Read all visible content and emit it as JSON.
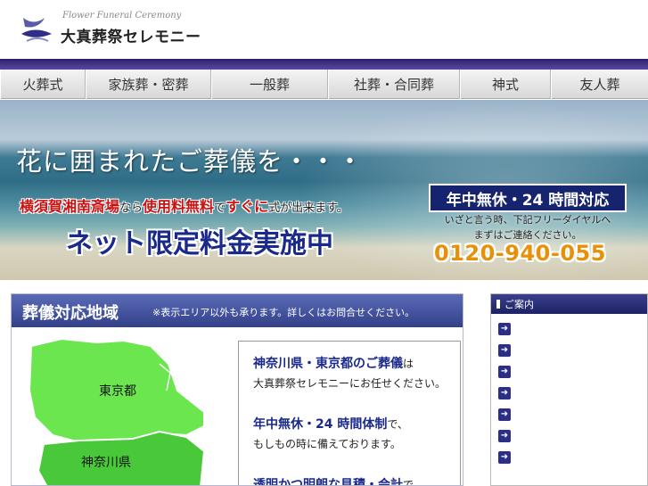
{
  "header": {
    "logo_en": "Flower Funeral Ceremony",
    "logo_jp": "大真葬祭セレモニー"
  },
  "nav": {
    "items": [
      {
        "label": "火葬式"
      },
      {
        "label": "家族葬・密葬"
      },
      {
        "label": "一般葬"
      },
      {
        "label": "社葬・合同葬"
      },
      {
        "label": "神式"
      },
      {
        "label": "友人葬"
      }
    ]
  },
  "hero": {
    "title": "花に囲まれたご葬儀を・・・",
    "sub_part1": "横須賀湘南斎場",
    "sub_part2": "なら",
    "sub_part3": "使用料無料",
    "sub_part4": "で",
    "sub_part5": "すぐに",
    "sub_part6": "式が出来ます。",
    "net": "ネット限定料金実施中",
    "promo_head": "年中無休・24 時間対応",
    "promo_line1": "いざと言う時、下記フリーダイヤルへ",
    "promo_line2": "まずはご連絡ください。",
    "promo_phone": "0120-940-055"
  },
  "main": {
    "title": "葬儀対応地域",
    "note": "※表示エリア以外も承ります。詳しくはお問合せください。",
    "map_tokyo": "東京都",
    "map_kanagawa": "神奈川県",
    "info1_big": "神奈川県・東京都のご葬儀",
    "info1_small": "は",
    "info1_line2": "大真葬祭セレモニーにお任せください。",
    "info2_big": "年中無休・24 時間体制",
    "info2_small": "で、",
    "info2_line2": "もしもの時に備えております。",
    "info3_big": "透明かつ明朗な見積・会計",
    "info3_small": "で"
  },
  "sidebar": {
    "title": "ご案内",
    "arrow_icon": "arrow-right-icon",
    "item_count_visible": 7
  },
  "colors": {
    "nav_bar": "#2e1f6e",
    "main_bar": "#33408a",
    "map_green": "#5ee24a",
    "accent_red": "#cc1111",
    "phone_orange": "#e8900a"
  }
}
